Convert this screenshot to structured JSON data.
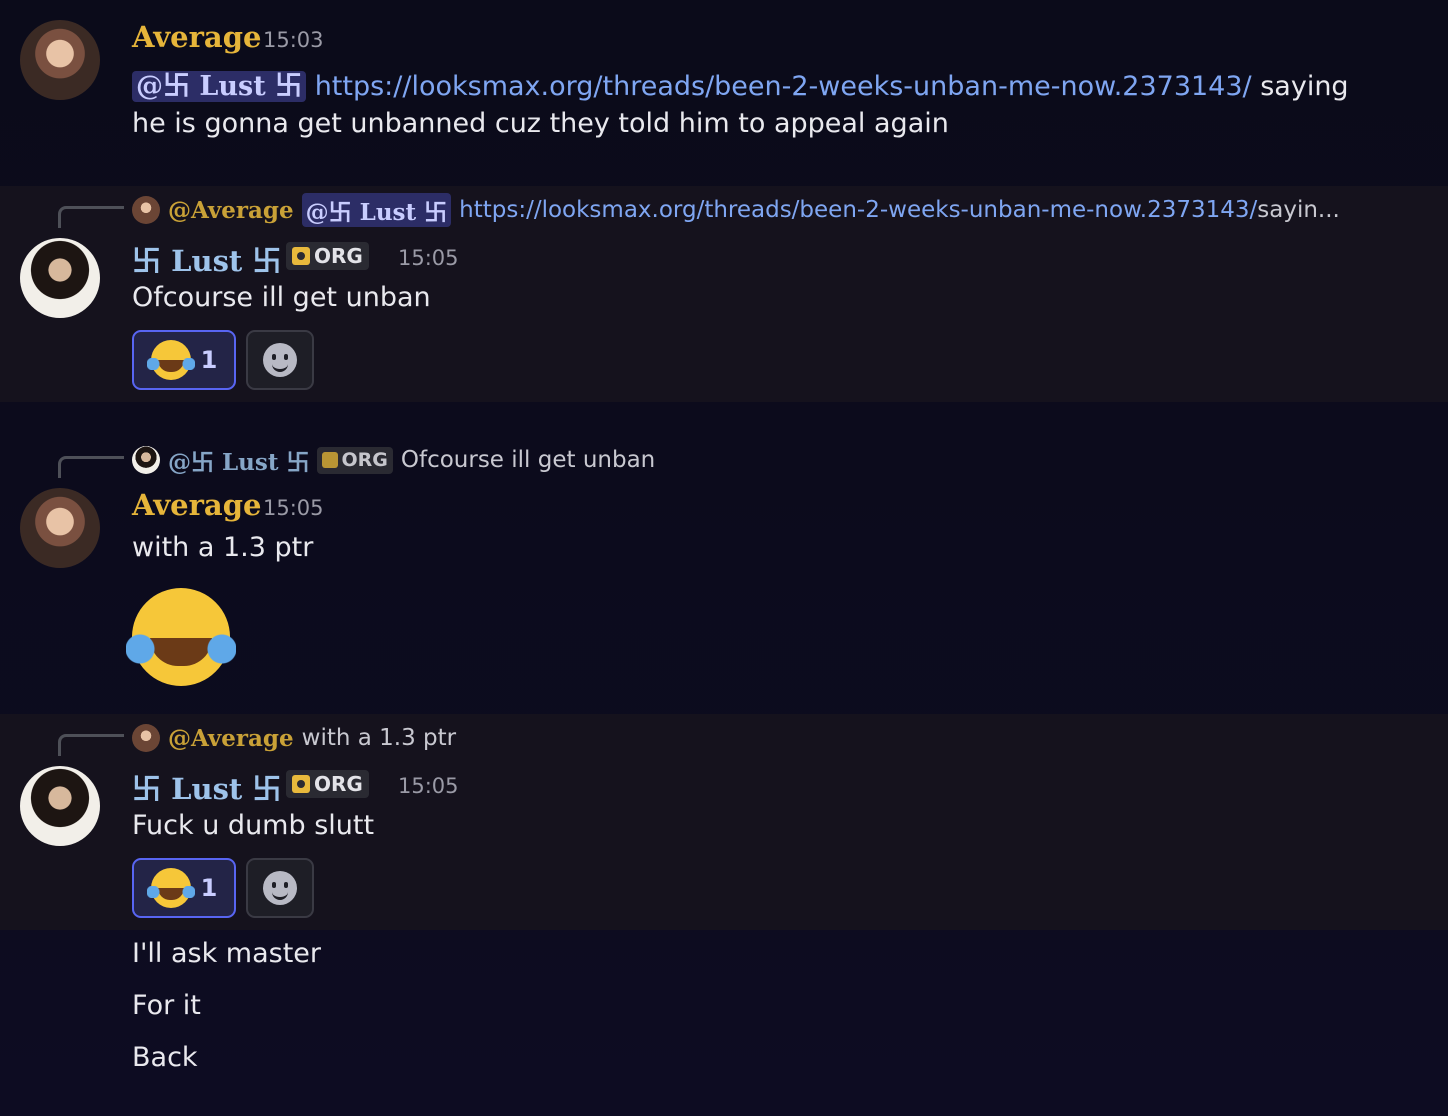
{
  "colors": {
    "background": "#0c0b1c",
    "highlight_row": "#15121d",
    "average_name": "#e6b53a",
    "lust_name": "#9ec3ea",
    "link": "#7fa6f2",
    "mention_bg": "#2c2d66",
    "reaction_active_border": "#5865f2"
  },
  "messages": [
    {
      "author": "Average",
      "time": "15:03",
      "mention": "@卐 Lust 卐",
      "link": "https://looksmax.org/threads/been-2-weeks-unban-me-now.2373143/",
      "line1_suffix": " saying",
      "line2": "he is gonna get unbanned cuz they told him to appeal again"
    },
    {
      "reply": {
        "author": "@Average",
        "mention": "@卐 Lust 卐",
        "link": "https://looksmax.org/threads/been-2-weeks-unban-me-now.2373143/",
        "suffix": " sayin..."
      },
      "author": "卐 Lust 卐",
      "badge": "ORG",
      "badge_icon": "crown-icon",
      "time": "15:05",
      "text": "Ofcourse ill get unban",
      "reaction": {
        "emoji": "joy-emoji",
        "count": "1"
      },
      "add_reaction_icon": "add-reaction-icon"
    },
    {
      "reply": {
        "author": "@卐 Lust 卐",
        "badge": "ORG",
        "text": "Ofcourse ill get unban"
      },
      "author": "Average",
      "time": "15:05",
      "text": "with a 1.3 ptr",
      "big_emoji": "joy-emoji"
    },
    {
      "reply": {
        "author": "@Average",
        "text": "with a 1.3 ptr"
      },
      "author": "卐 Lust 卐",
      "badge": "ORG",
      "time": "15:05",
      "text": "Fuck u dumb slutt",
      "reaction": {
        "emoji": "joy-emoji",
        "count": "1"
      },
      "add_reaction_icon": "add-reaction-icon"
    }
  ],
  "followups": [
    "I'll ask master",
    "For it",
    "Back"
  ]
}
